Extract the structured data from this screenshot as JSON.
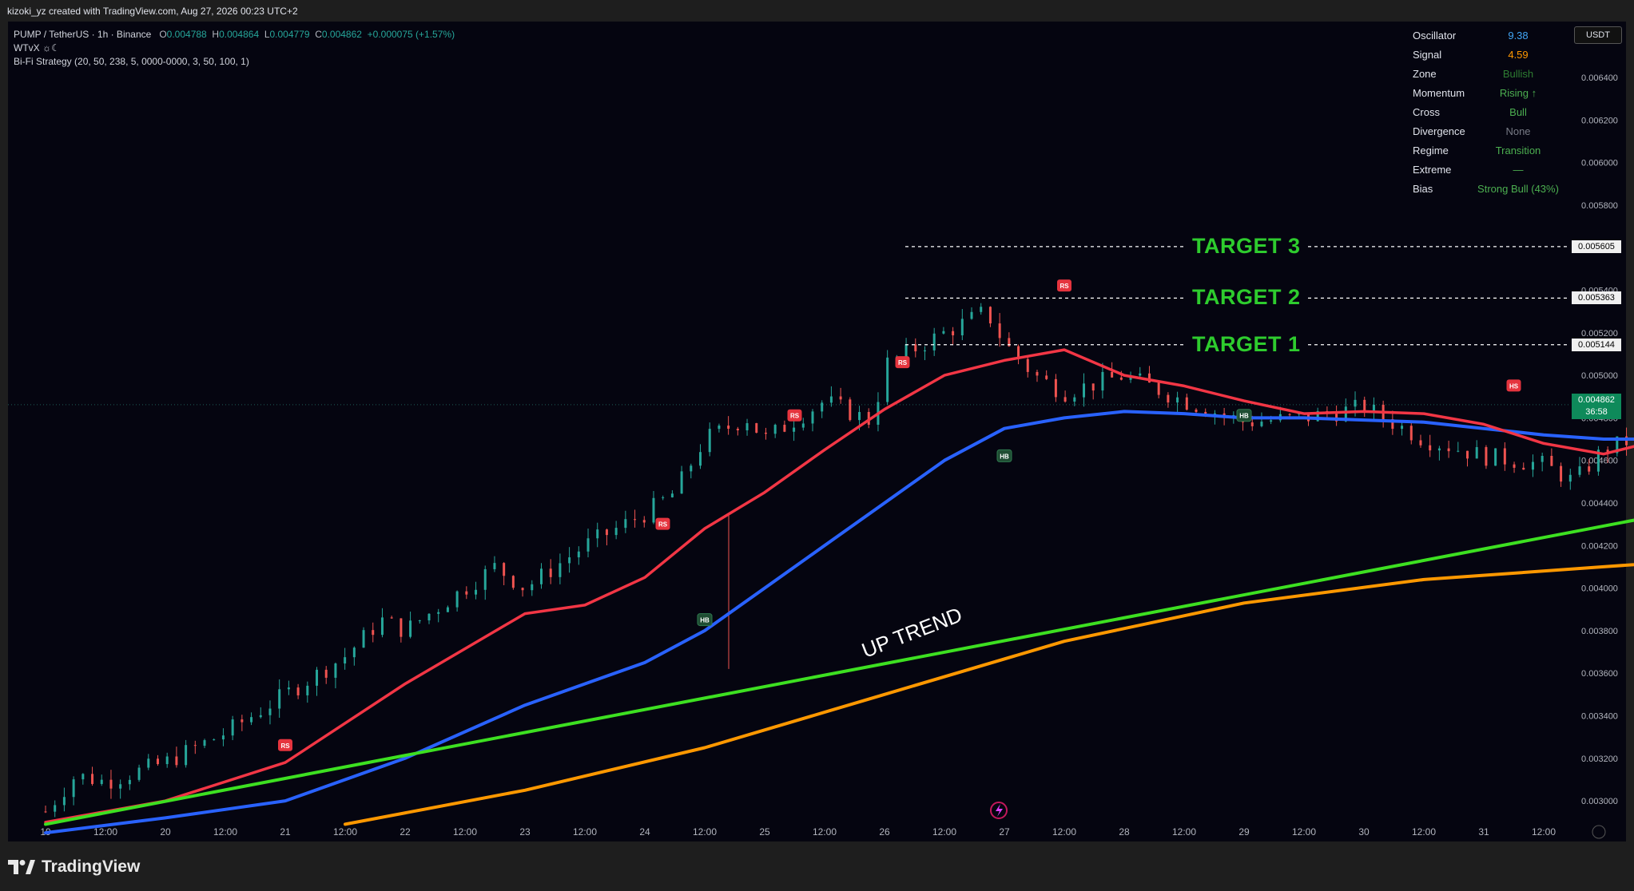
{
  "header": {
    "credit": "kizoki_yz created with TradingView.com, Aug 27, 2026 00:23 UTC+2",
    "symbol": "PUMP / TetherUS · 1h · Binance",
    "o_label": "O",
    "o": "0.004788",
    "h_label": "H",
    "h": "0.004864",
    "l_label": "L",
    "l": "0.004779",
    "c_label": "C",
    "c": "0.004862",
    "change": "+0.000075 (+1.57%)",
    "indicator1": "WTvX ☼☾",
    "indicator2": "Bi-Fi Strategy (20, 50, 238, 5, 0000-0000, 3, 50, 100, 1)"
  },
  "stats": [
    {
      "key": "Oscillator",
      "value": "9.38",
      "color": "#42a5f5"
    },
    {
      "key": "Signal",
      "value": "4.59",
      "color": "#ff9800"
    },
    {
      "key": "Zone",
      "value": "Bullish",
      "color": "#2e7d32"
    },
    {
      "key": "Momentum",
      "value": "Rising ↑",
      "color": "#4caf50"
    },
    {
      "key": "Cross",
      "value": "Bull",
      "color": "#4caf50"
    },
    {
      "key": "Divergence",
      "value": "None",
      "color": "#787b86"
    },
    {
      "key": "Regime",
      "value": "Transition",
      "color": "#4caf50"
    },
    {
      "key": "Extreme",
      "value": "—",
      "color": "#4caf50"
    },
    {
      "key": "Bias",
      "value": "Strong Bull (43%)",
      "color": "#4caf50"
    }
  ],
  "currency": "USDT",
  "current_price": "0.004862",
  "countdown": "36:58",
  "targets": [
    {
      "label": "TARGET 3",
      "price": "0.005605",
      "value": 0.005605
    },
    {
      "label": "TARGET 2",
      "price": "0.005363",
      "value": 0.005363
    },
    {
      "label": "TARGET 1",
      "price": "0.005144",
      "value": 0.005144
    }
  ],
  "trend_label": "UP TREND",
  "brand": "TradingView",
  "colors": {
    "up": "#26a69a",
    "down": "#ef5350",
    "ema_fast": "#f23645",
    "ema_mid": "#2962ff",
    "ema_slow": "#ff9800",
    "trendline": "#3de021",
    "target_text": "#2ecc2e"
  },
  "chart_data": {
    "type": "candlestick",
    "x_ticks": [
      "19",
      "12:00",
      "20",
      "12:00",
      "21",
      "12:00",
      "22",
      "12:00",
      "23",
      "12:00",
      "24",
      "12:00",
      "25",
      "12:00",
      "26",
      "12:00",
      "27",
      "12:00",
      "28",
      "12:00",
      "29",
      "12:00",
      "30",
      "12:00",
      "31",
      "12:00"
    ],
    "y_ticks": [
      "0.006400",
      "0.006200",
      "0.006000",
      "0.005800",
      "0.005600",
      "0.005400",
      "0.005200",
      "0.005000",
      "0.004800",
      "0.004600",
      "0.004400",
      "0.004200",
      "0.004000",
      "0.003800",
      "0.003600",
      "0.003400",
      "0.003200",
      "0.003000"
    ],
    "ylim": [
      0.00289,
      0.00656
    ],
    "price_path": [
      [
        0,
        0.00295
      ],
      [
        0.5,
        0.00312
      ],
      [
        1,
        0.00309
      ],
      [
        2,
        0.00318
      ],
      [
        3,
        0.00332
      ],
      [
        4,
        0.0035
      ],
      [
        5,
        0.00368
      ],
      [
        5.6,
        0.00385
      ],
      [
        6,
        0.0038
      ],
      [
        7,
        0.004
      ],
      [
        7.5,
        0.0041
      ],
      [
        8,
        0.004
      ],
      [
        9,
        0.0042
      ],
      [
        10,
        0.00435
      ],
      [
        10.5,
        0.00445
      ],
      [
        11,
        0.0047
      ],
      [
        11.7,
        0.0048
      ],
      [
        12,
        0.0047
      ],
      [
        13,
        0.00488
      ],
      [
        13.8,
        0.00478
      ],
      [
        14,
        0.00505
      ],
      [
        15,
        0.0052
      ],
      [
        15.7,
        0.0053
      ],
      [
        16,
        0.00515
      ],
      [
        16.5,
        0.005
      ],
      [
        17,
        0.00492
      ],
      [
        18,
        0.005
      ],
      [
        19,
        0.00488
      ],
      [
        20,
        0.00478
      ],
      [
        21,
        0.0048
      ],
      [
        22,
        0.00485
      ],
      [
        23,
        0.0047
      ],
      [
        24,
        0.00462
      ],
      [
        25,
        0.00458
      ],
      [
        25.5,
        0.0045
      ],
      [
        26,
        0.00465
      ],
      [
        27,
        0.00475
      ],
      [
        28,
        0.00482
      ],
      [
        29,
        0.0047
      ],
      [
        30,
        0.00478
      ],
      [
        31,
        0.00475
      ],
      [
        32,
        0.004862
      ]
    ],
    "ema_fast": [
      [
        0,
        0.0029
      ],
      [
        2,
        0.003
      ],
      [
        4,
        0.00318
      ],
      [
        6,
        0.00355
      ],
      [
        8,
        0.00388
      ],
      [
        9,
        0.00392
      ],
      [
        10,
        0.00405
      ],
      [
        11,
        0.00428
      ],
      [
        12,
        0.00445
      ],
      [
        13,
        0.00465
      ],
      [
        14,
        0.00484
      ],
      [
        15,
        0.005
      ],
      [
        16,
        0.00507
      ],
      [
        17,
        0.00512
      ],
      [
        18,
        0.005
      ],
      [
        19,
        0.00495
      ],
      [
        20,
        0.00488
      ],
      [
        21,
        0.00482
      ],
      [
        22,
        0.00483
      ],
      [
        23,
        0.00482
      ],
      [
        24,
        0.00477
      ],
      [
        25,
        0.00468
      ],
      [
        26,
        0.00463
      ],
      [
        27,
        0.0047
      ],
      [
        28,
        0.00474
      ],
      [
        29,
        0.00475
      ],
      [
        30,
        0.00472
      ],
      [
        31,
        0.00472
      ],
      [
        32,
        0.00473
      ]
    ],
    "ema_mid": [
      [
        0,
        0.00285
      ],
      [
        2,
        0.00292
      ],
      [
        4,
        0.003
      ],
      [
        6,
        0.0032
      ],
      [
        8,
        0.00345
      ],
      [
        10,
        0.00365
      ],
      [
        11,
        0.0038
      ],
      [
        12,
        0.004
      ],
      [
        13,
        0.0042
      ],
      [
        14,
        0.0044
      ],
      [
        15,
        0.0046
      ],
      [
        16,
        0.00475
      ],
      [
        17,
        0.0048
      ],
      [
        18,
        0.00483
      ],
      [
        19,
        0.00482
      ],
      [
        20,
        0.0048
      ],
      [
        21,
        0.0048
      ],
      [
        22,
        0.00479
      ],
      [
        23,
        0.00478
      ],
      [
        24,
        0.00475
      ],
      [
        25,
        0.00472
      ],
      [
        26,
        0.0047
      ],
      [
        27,
        0.0047
      ],
      [
        28,
        0.00472
      ],
      [
        29,
        0.00473
      ],
      [
        30,
        0.00473
      ],
      [
        31,
        0.00473
      ],
      [
        32,
        0.00474
      ]
    ],
    "ema_slow": [
      [
        5,
        0.00289
      ],
      [
        8,
        0.00305
      ],
      [
        11,
        0.00325
      ],
      [
        14,
        0.0035
      ],
      [
        17,
        0.00375
      ],
      [
        20,
        0.00393
      ],
      [
        23,
        0.00404
      ],
      [
        26,
        0.0041
      ],
      [
        29,
        0.00416
      ],
      [
        32,
        0.0042
      ]
    ],
    "trendline": {
      "start": [
        0,
        0.00289
      ],
      "end": [
        34.5,
        0.00475
      ]
    },
    "projection": [
      [
        32,
        0.00462
      ],
      [
        33.5,
        0.00515
      ],
      [
        34.2,
        0.005
      ],
      [
        35.3,
        0.00543
      ],
      [
        36,
        0.00513
      ],
      [
        37,
        0.00578
      ]
    ],
    "signals": [
      {
        "label": "RS",
        "type": "sell",
        "x": 4.0,
        "y": 0.00326
      },
      {
        "label": "RS",
        "type": "sell",
        "x": 10.3,
        "y": 0.0043
      },
      {
        "label": "RS",
        "type": "sell",
        "x": 12.5,
        "y": 0.00481
      },
      {
        "label": "RS",
        "type": "sell",
        "x": 14.3,
        "y": 0.00506
      },
      {
        "label": "RS",
        "type": "sell",
        "x": 17.0,
        "y": 0.00542
      },
      {
        "label": "HS",
        "type": "sell",
        "x": 24.5,
        "y": 0.00495
      },
      {
        "label": "HS",
        "type": "sell",
        "x": 28.0,
        "y": 0.0049
      },
      {
        "label": "HB",
        "type": "buy",
        "x": 11.0,
        "y": 0.00385
      },
      {
        "label": "HB",
        "type": "buy",
        "x": 16.0,
        "y": 0.00462
      },
      {
        "label": "HB",
        "type": "buy",
        "x": 20.0,
        "y": 0.00481
      },
      {
        "label": "RB",
        "type": "buy",
        "x": 27.0,
        "y": 0.00443
      }
    ]
  }
}
